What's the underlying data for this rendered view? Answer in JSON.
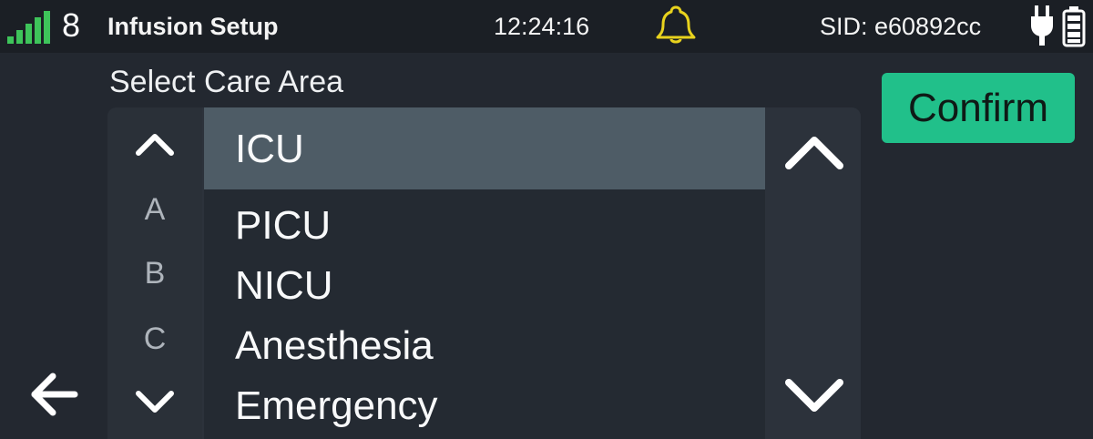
{
  "status_bar": {
    "signal_count": "8",
    "title": "Infusion Setup",
    "time": "12:24:16",
    "sid": "SID: e60892cc",
    "icons": {
      "signal": "signal-bars-icon",
      "bell": "bell-icon",
      "power": "power-plug-icon",
      "battery": "battery-icon"
    },
    "colors": {
      "signal": "#3ec45a",
      "bell": "#e8d21d"
    }
  },
  "main": {
    "heading": "Select Care Area",
    "alpha_index": [
      "A",
      "B",
      "C"
    ],
    "care_areas": [
      {
        "label": "ICU",
        "selected": true
      },
      {
        "label": "PICU",
        "selected": false
      },
      {
        "label": "NICU",
        "selected": false
      },
      {
        "label": "Anesthesia",
        "selected": false
      },
      {
        "label": "Emergency",
        "selected": false
      }
    ],
    "icons": {
      "alpha_up": "chevron-up-icon",
      "alpha_down": "chevron-down-icon",
      "scroll_up": "chevron-up-icon",
      "scroll_down": "chevron-down-icon",
      "back": "arrow-left-icon"
    }
  },
  "actions": {
    "confirm_label": "Confirm",
    "confirm_color": "#21c08a"
  }
}
